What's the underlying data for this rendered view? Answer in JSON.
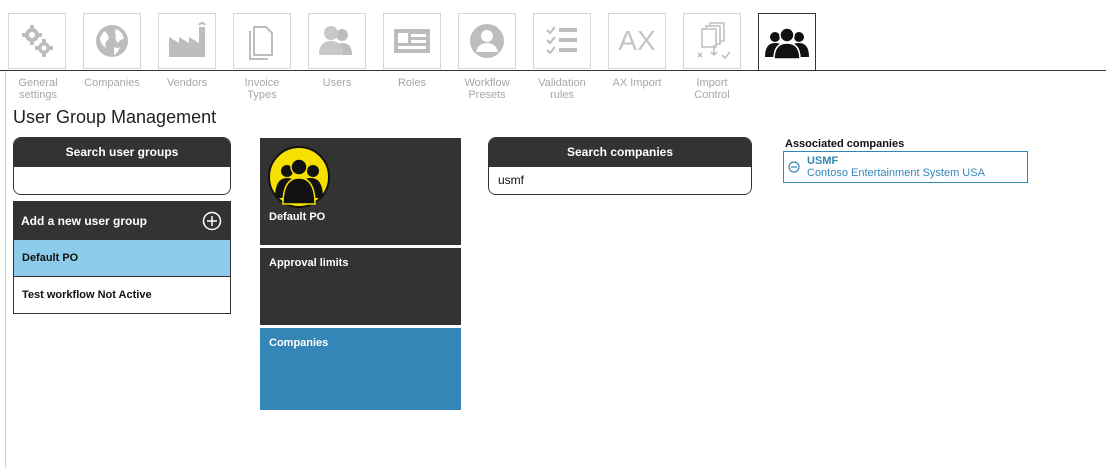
{
  "nav": {
    "items": [
      {
        "label": "General\nsettings",
        "icon": "gears-icon"
      },
      {
        "label": "Companies",
        "icon": "globe-icon"
      },
      {
        "label": "Vendors",
        "icon": "factory-icon"
      },
      {
        "label": "Invoice\nTypes",
        "icon": "documents-icon"
      },
      {
        "label": "Users",
        "icon": "users-icon"
      },
      {
        "label": "Roles",
        "icon": "id-card-icon"
      },
      {
        "label": "Workflow\nPresets",
        "icon": "user-circle-icon"
      },
      {
        "label": "Validation\nrules",
        "icon": "checklist-icon"
      },
      {
        "label": "AX Import",
        "icon": "ax-icon"
      },
      {
        "label": "Import\nControl",
        "icon": "import-control-icon"
      },
      {
        "label": "",
        "icon": "user-group-icon"
      }
    ],
    "ax_text": "AX"
  },
  "page_title": "User Group Management",
  "search_groups": {
    "header": "Search user groups",
    "value": ""
  },
  "groups": {
    "add_label": "Add a new user group",
    "items": [
      {
        "label": "Default PO",
        "selected": true
      },
      {
        "label": "Test workflow Not Active",
        "selected": false
      }
    ]
  },
  "detail": {
    "group_name": "Default PO",
    "approval_label": "Approval limits",
    "companies_label": "Companies"
  },
  "search_companies": {
    "header": "Search companies",
    "value": "usmf"
  },
  "associated": {
    "title": "Associated companies",
    "items": [
      {
        "code": "USMF",
        "name": "Contoso Entertainment System USA"
      }
    ]
  },
  "colors": {
    "dark": "#333333",
    "accent_blue": "#3486b6",
    "selected_row": "#8dcbea",
    "avatar_yellow": "#f5e000"
  }
}
